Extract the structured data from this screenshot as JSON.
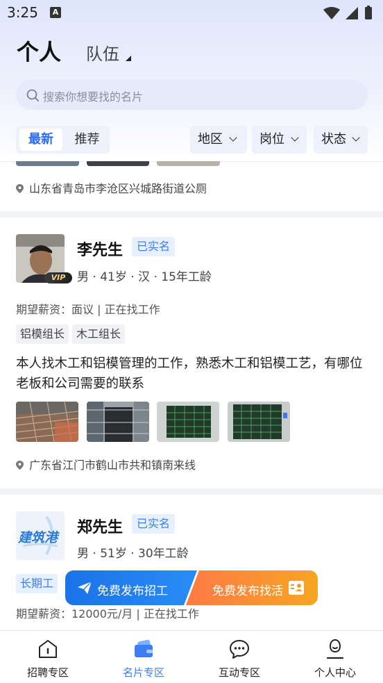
{
  "status_bar": {
    "time": "3:25",
    "notification_letter": "A"
  },
  "top_tabs": {
    "person": "个人",
    "team": "队伍"
  },
  "search": {
    "placeholder": "搜索你想要找的名片"
  },
  "sort": {
    "latest": "最新",
    "recommend": "推荐"
  },
  "filters": [
    "地区",
    "岗位",
    "状态"
  ],
  "cards": [
    {
      "location": "山东省青岛市李沧区兴城路街道公厕"
    },
    {
      "name": "李先生",
      "verified": "已实名",
      "vip": "VIP",
      "meta": "男 · 41岁 · 汉 · 15年工龄",
      "salary": "期望薪资：面议 | 正在找工作",
      "tags": [
        "铝模组长",
        "木工组长"
      ],
      "description": "本人找木工和铝模管理的工作，熟悉木工和铝模工艺，有哪位老板和公司需要的联系",
      "location": "广东省江门市鹤山市共和镇南来线"
    },
    {
      "name": "郑先生",
      "verified": "已实名",
      "avatar_text": "建筑港",
      "meta": "男 · 51岁 · 30年工龄",
      "tags": [
        "长期工"
      ],
      "salary": "期望薪资：12000元/月 | 正在找工作"
    }
  ],
  "fab": {
    "recruit": "免费发布招工",
    "find_job": "免费发布找活"
  },
  "bottom_nav": [
    {
      "label": "招聘专区",
      "icon": "home-icon"
    },
    {
      "label": "名片专区",
      "icon": "card-wallet-icon"
    },
    {
      "label": "互动专区",
      "icon": "chat-icon"
    },
    {
      "label": "个人中心",
      "icon": "person-icon"
    }
  ],
  "colors": {
    "accent": "#3d7ff2",
    "recruit": "#1a73e8",
    "find_job": "#f5a623"
  }
}
